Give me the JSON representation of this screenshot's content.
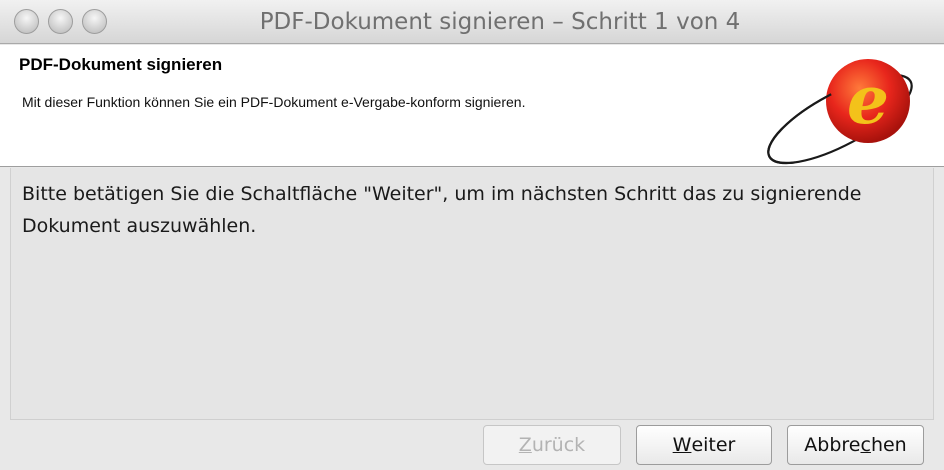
{
  "window": {
    "title": "PDF-Dokument signieren – Schritt 1 von 4"
  },
  "banner": {
    "heading": "PDF-Dokument signieren",
    "description": "Mit dieser Funktion können Sie ein PDF-Dokument e-Vergabe-konform signieren.",
    "logo_icon": "e-vergabe-logo-icon"
  },
  "content": {
    "message": "Bitte betätigen Sie die Schaltfläche \"Weiter\", um im nächsten Schritt das zu signierende Dokument auszuwählen."
  },
  "buttons": {
    "back": {
      "mnemonic": "Z",
      "rest": "urück",
      "enabled": false
    },
    "next": {
      "mnemonic": "W",
      "rest": "eiter",
      "enabled": true
    },
    "cancel": {
      "pre": "Abbre",
      "mnemonic": "c",
      "rest": "hen",
      "enabled": true
    }
  },
  "colors": {
    "logo_red": "#e8261c",
    "logo_yellow": "#f3c21a",
    "disabled_text": "#b3b3b3"
  }
}
